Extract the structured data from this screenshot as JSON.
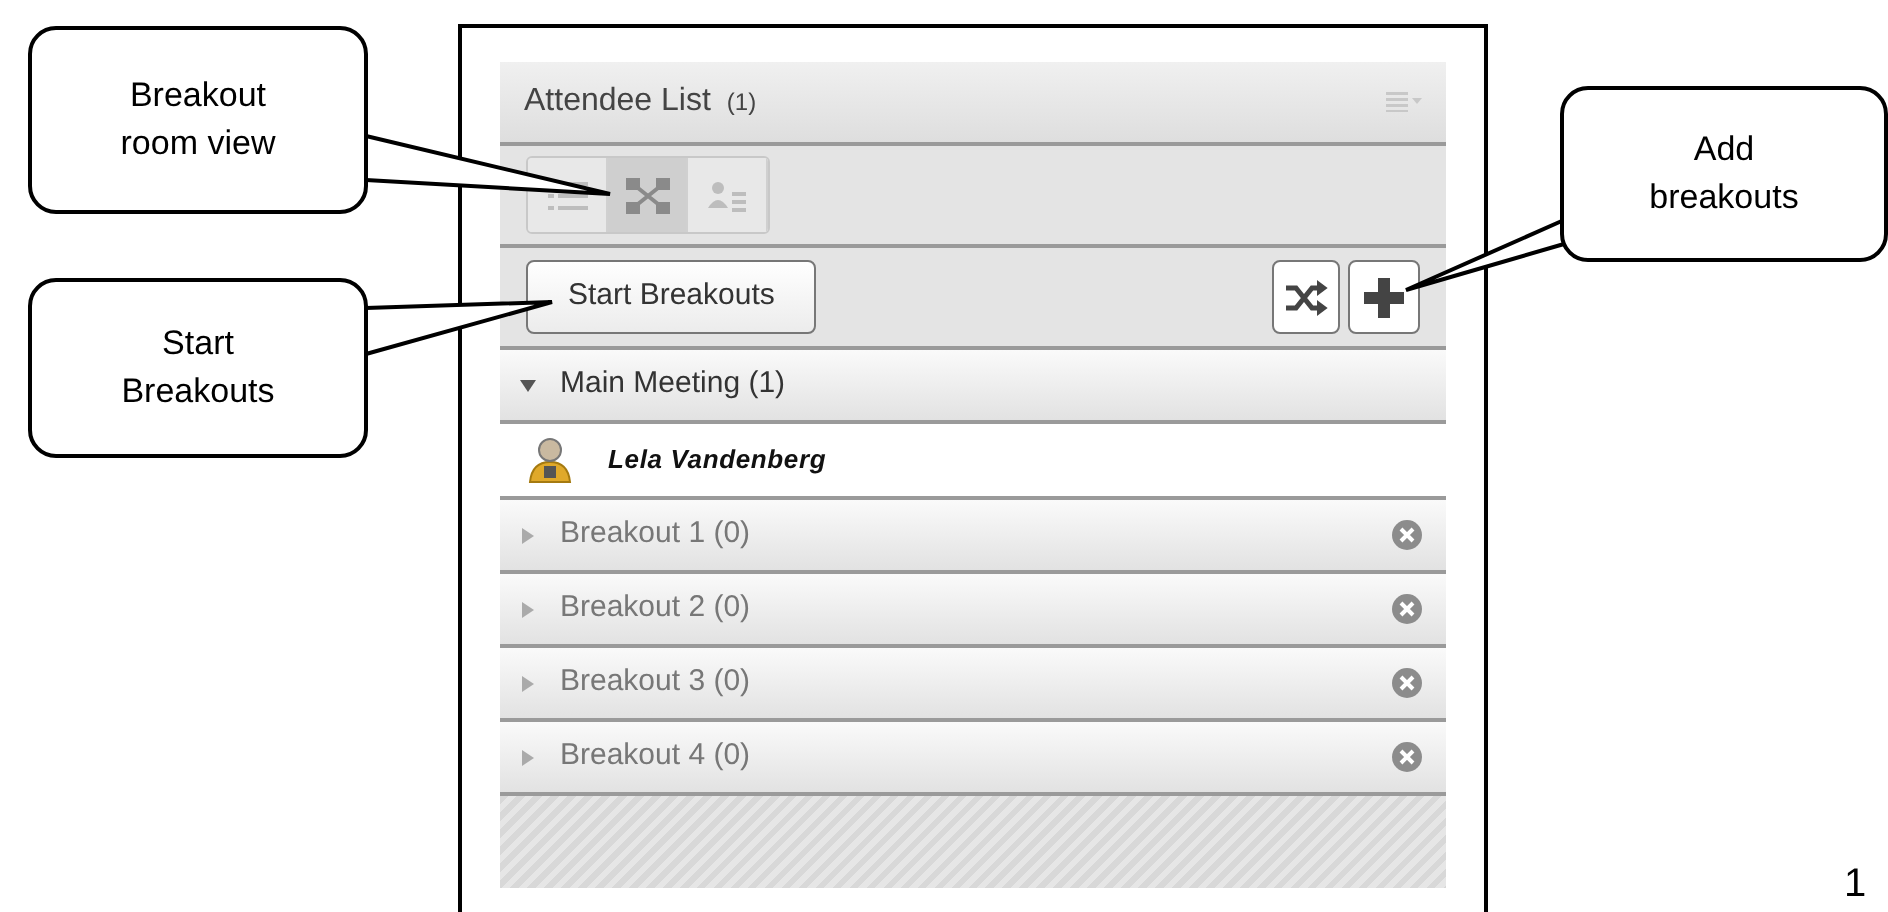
{
  "panel": {
    "title": "Attendee List",
    "count": "(1)",
    "views": [
      {
        "kind": "list",
        "selected": false
      },
      {
        "kind": "grid",
        "selected": true
      },
      {
        "kind": "person",
        "selected": false
      }
    ],
    "start_button": "Start Breakouts",
    "groups": [
      {
        "label": "Main Meeting (1)",
        "expanded": true,
        "removable": false,
        "children": [
          {
            "name": "Lela Vandenberg"
          }
        ]
      },
      {
        "label": "Breakout 1 (0)",
        "expanded": false,
        "removable": true
      },
      {
        "label": "Breakout 2 (0)",
        "expanded": false,
        "removable": true
      },
      {
        "label": "Breakout 3 (0)",
        "expanded": false,
        "removable": true
      },
      {
        "label": "Breakout 4 (0)",
        "expanded": false,
        "removable": true
      }
    ]
  },
  "callouts": [
    {
      "text": "Breakout room view"
    },
    {
      "text": "Start Breakouts"
    },
    {
      "text": "Add breakouts"
    }
  ],
  "page_number": "1"
}
